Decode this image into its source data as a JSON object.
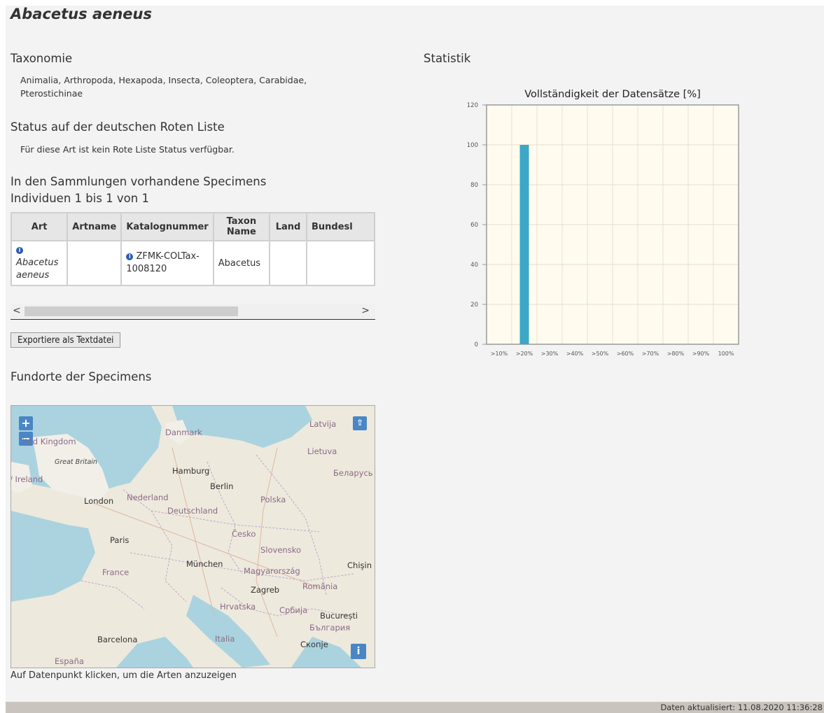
{
  "title": "Abacetus aeneus",
  "taxonomy": {
    "heading": "Taxonomie",
    "line1": "Animalia, Arthropoda, Hexapoda, Insecta, Coleoptera, Carabidae,",
    "line2": "Pterostichinae"
  },
  "redlist": {
    "heading": "Status auf der deutschen Roten Liste",
    "text": "Für diese Art ist kein Rote Liste Status verfügbar."
  },
  "specimens": {
    "heading": "In den Sammlungen vorhandene Specimens",
    "subheading": "Individuen 1 bis 1 von 1",
    "columns": [
      "Art",
      "Artname",
      "Katalognummer",
      "Taxon Name",
      "Land",
      "Bundesl"
    ],
    "row": {
      "art_line1": "Abacetus",
      "art_line2": "aeneus",
      "artname": "",
      "katalognummer_line1": "ZFMK-COLTax-",
      "katalognummer_line2": "1008120",
      "taxon_name": "Abacetus",
      "land": "",
      "bundesland": ""
    },
    "export_label": "Exportiere als Textdatei"
  },
  "map": {
    "heading": "Fundorte der Specimens",
    "caption": "Auf Datenpunkt klicken, um die Arten anzuzeigen",
    "zoom_in": "+",
    "zoom_out": "−",
    "labels": {
      "uk": "ited Kingdom",
      "gb": "Great Britain",
      "ireland": "/ Ireland",
      "danmark": "Danmark",
      "latvija": "Latvija",
      "lietuva": "Lietuva",
      "hamburg": "Hamburg",
      "berlin": "Berlin",
      "belarus": "Беларусь",
      "london": "London",
      "nederland": "Nederland",
      "polska": "Polska",
      "deutschland": "Deutschland",
      "cesko": "Česko",
      "paris": "Paris",
      "slovensko": "Slovensko",
      "muenchen": "München",
      "france": "France",
      "magyarorszag": "Magyarország",
      "chisinau": "Chişin",
      "zagreb": "Zagreb",
      "romania": "România",
      "hrvatska": "Hrvatska",
      "srbija": "Србија",
      "bucuresti": "București",
      "bulgaria": "България",
      "barcelona": "Barcelona",
      "italia": "Italia",
      "skopje": "Скопје",
      "espana": "España"
    }
  },
  "statistik": {
    "heading": "Statistik"
  },
  "chart_data": {
    "type": "bar",
    "title": "Vollständigkeit der Datensätze [%]",
    "categories": [
      ">10%",
      ">20%",
      ">30%",
      ">40%",
      ">50%",
      ">60%",
      ">70%",
      ">80%",
      ">90%",
      "100%"
    ],
    "values": [
      0,
      100,
      0,
      0,
      0,
      0,
      0,
      0,
      0,
      0
    ],
    "ylim": [
      0,
      120
    ],
    "yticks": [
      0,
      20,
      40,
      60,
      80,
      100,
      120
    ],
    "grid": true,
    "bar_color": "#3aa8c6"
  },
  "footer": {
    "updated": "Daten aktualisiert: 11.08.2020 11:36:28"
  }
}
